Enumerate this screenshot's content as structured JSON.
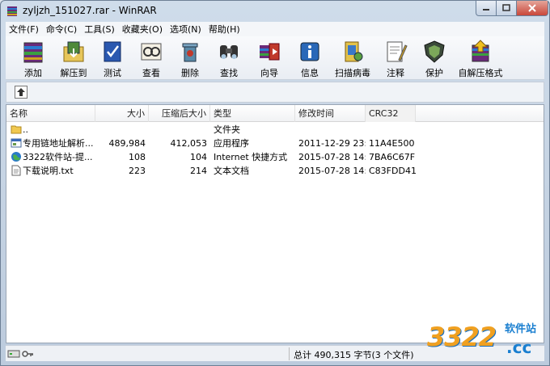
{
  "window": {
    "title": "zyljzh_151027.rar - WinRAR"
  },
  "menu": [
    "文件(F)",
    "命令(C)",
    "工具(S)",
    "收藏夹(O)",
    "选项(N)",
    "帮助(H)"
  ],
  "toolbar": [
    {
      "label": "添加",
      "icon": "add-archive-icon"
    },
    {
      "label": "解压到",
      "icon": "extract-to-icon"
    },
    {
      "label": "测试",
      "icon": "test-icon"
    },
    {
      "label": "查看",
      "icon": "view-icon"
    },
    {
      "label": "删除",
      "icon": "delete-icon"
    },
    {
      "label": "查找",
      "icon": "find-icon"
    },
    {
      "label": "向导",
      "icon": "wizard-icon"
    },
    {
      "label": "信息",
      "icon": "info-icon"
    },
    {
      "label": "扫描病毒",
      "icon": "virus-scan-icon"
    },
    {
      "label": "注释",
      "icon": "comment-icon"
    },
    {
      "label": "保护",
      "icon": "protect-icon"
    },
    {
      "label": "自解压格式",
      "icon": "sfx-icon"
    }
  ],
  "columns": {
    "name": "名称",
    "size": "大小",
    "packed": "压缩后大小",
    "type": "类型",
    "modified": "修改时间",
    "crc": "CRC32"
  },
  "rows": [
    {
      "name": "..",
      "size": "",
      "packed": "",
      "type": "文件夹",
      "modified": "",
      "crc": "",
      "icon": "folder-icon"
    },
    {
      "name": "专用链地址解析...",
      "size": "489,984",
      "packed": "412,053",
      "type": "应用程序",
      "modified": "2011-12-29 23:19",
      "crc": "11A4E500",
      "icon": "exe-icon"
    },
    {
      "name": "3322软件站-提...",
      "size": "108",
      "packed": "104",
      "type": "Internet 快捷方式",
      "modified": "2015-07-28 14:07",
      "crc": "7BA6C67F",
      "icon": "internet-shortcut-icon"
    },
    {
      "name": "下载说明.txt",
      "size": "223",
      "packed": "214",
      "type": "文本文档",
      "modified": "2015-07-28 14:10",
      "crc": "C83FDD41",
      "icon": "text-file-icon"
    }
  ],
  "status": {
    "summary": "总计 490,315 字节(3 个文件)"
  },
  "watermark": {
    "big": "3322",
    "small": "软件站",
    "domain": ".cc"
  }
}
